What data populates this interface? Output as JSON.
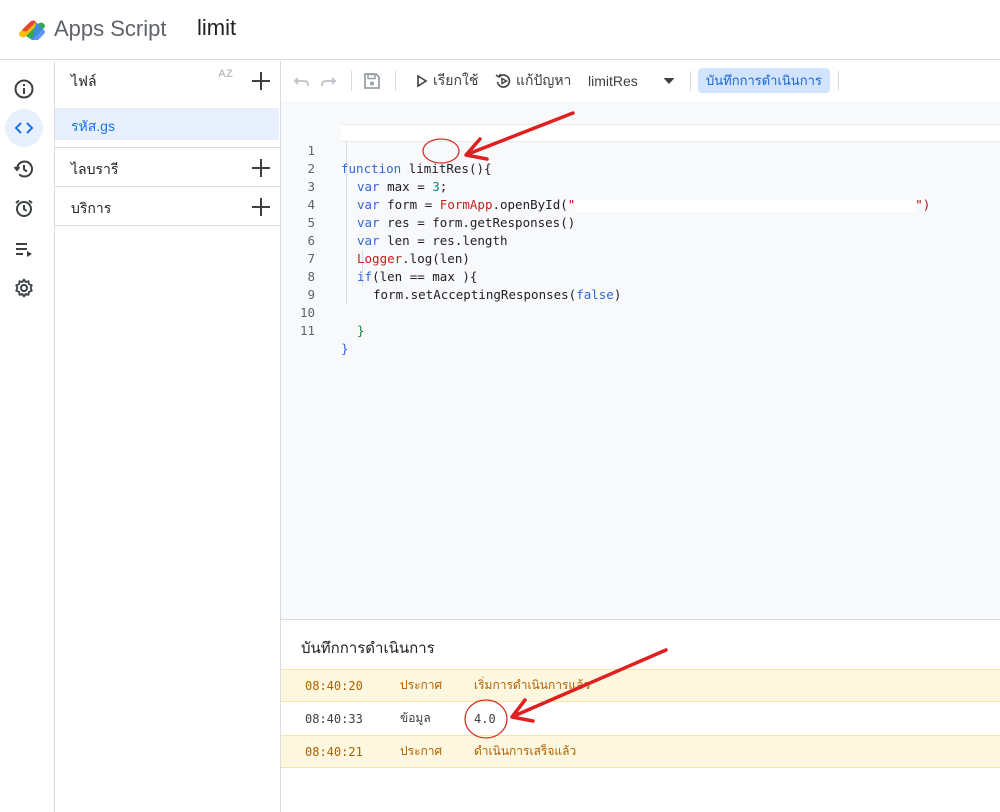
{
  "header": {
    "app_name": "Apps Script",
    "project_name": "limit"
  },
  "rail": {
    "items": [
      "info-icon",
      "code-icon",
      "history-icon",
      "alarm-icon",
      "executions-icon",
      "settings-icon"
    ]
  },
  "files": {
    "title": "ไฟล์",
    "sort_label": "AZ",
    "active_file": "รหัส.gs",
    "sections": [
      "ไลบรารี",
      "บริการ"
    ]
  },
  "toolbar": {
    "run_label": "เรียกใช้",
    "debug_label": "แก้ปัญหา",
    "function_name": "limitRes",
    "log_label": "บันทึกการดำเนินการ"
  },
  "code": {
    "line_numbers": [
      "1",
      "2",
      "3",
      "4",
      "5",
      "6",
      "7",
      "8",
      "9",
      "10",
      "11"
    ],
    "l1_kw": "function",
    "l1_rest": " limitRes(){",
    "l2_kw": "var",
    "l2_a": " max = ",
    "l2_num": "3",
    "l2_b": ";",
    "l3_kw": "var",
    "l3_a": " form = ",
    "l3_cls": "FormApp",
    "l3_b": ".openById(",
    "l3_q1": "\"",
    "l3_q2": "\")",
    "l4_kw": "var",
    "l4_a": " res = form.getResponses()",
    "l5_kw": "var",
    "l5_a": " len = res.length",
    "l6_cls": "Logger",
    "l6_a": ".log(len)",
    "l7_kw": "if",
    "l7_a": "(len == max ){",
    "l8_a": "form.setAcceptingResponses(",
    "l8_kw": "false",
    "l8_b": ")",
    "l10_a": "}",
    "l11_a": "}"
  },
  "log": {
    "title": "บันทึกการดำเนินการ",
    "rows": [
      {
        "time": "08:40:20",
        "type": "ประกาศ",
        "message": "เริ่มการดำเนินการแล้ว"
      },
      {
        "time": "08:40:33",
        "type": "ข้อมูล",
        "message": "4.0"
      },
      {
        "time": "08:40:21",
        "type": "ประกาศ",
        "message": "ดำเนินการเสร็จแล้ว"
      }
    ]
  },
  "colors": {
    "accent": "#1a73e8",
    "annotation": "#e02020",
    "warn_bg": "#fef7e0"
  }
}
